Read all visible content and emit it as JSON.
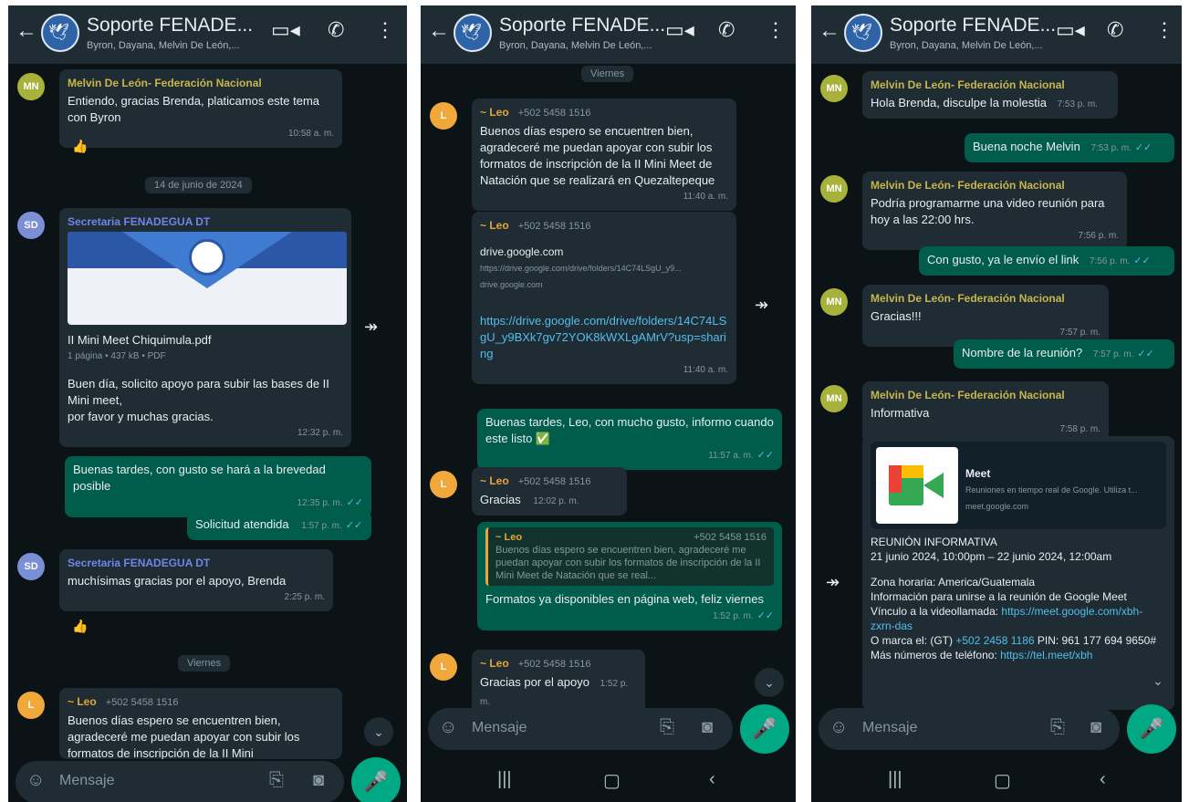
{
  "header": {
    "title": "Soporte FENADE...",
    "subtitle": "Byron, Dayana, Melvin De León,..."
  },
  "input": {
    "placeholder": "Mensaje"
  },
  "phone1": {
    "m1": {
      "sender": "Melvin De León- Federación Nacional",
      "text": "Entiendo, gracias Brenda, platicamos este tema con Byron",
      "time": "10:58 a. m.",
      "reaction": "👍"
    },
    "date1": "14 de junio de 2024",
    "m2": {
      "sender": "Secretaria FENADEGUA DT",
      "file": "II Mini Meet Chiquimula.pdf",
      "file_meta": "1 página • 437 kB • PDF",
      "text": "Buen día, solicito apoyo para subir las bases de II Mini meet,\npor favor y muchas gracias.",
      "time": "12:32 p. m."
    },
    "m3": {
      "text": "Buenas tardes, con gusto se hará a la brevedad posible",
      "time": "12:35 p. m."
    },
    "m4": {
      "text": "Solicitud atendida",
      "time": "1:57 p. m."
    },
    "m5": {
      "sender": "Secretaria FENADEGUA DT",
      "text": "muchísimas gracias por el apoyo, Brenda",
      "time": "2:25 p. m.",
      "reaction": "👍"
    },
    "date2": "Viernes",
    "m6": {
      "sender": "~ Leo",
      "phone": "+502 5458 1516",
      "text": "Buenos días espero se encuentren bien, agradeceré me puedan apoyar con subir los formatos de inscripción de la II Mini"
    }
  },
  "phone2": {
    "date": "Viernes",
    "m1": {
      "sender": "~ Leo",
      "phone": "+502 5458 1516",
      "text": "Buenos días espero se encuentren bien, agradeceré me puedan apoyar con subir los formatos de inscripción de la II Mini Meet de Natación que se realizará en Quezaltepeque",
      "time": "11:40 a. m."
    },
    "m2": {
      "sender": "~ Leo",
      "phone": "+502 5458 1516",
      "link_title": "drive.google.com",
      "link_url": "https://drive.google.com/drive/folders/14C74LSgU_y9...",
      "link_domain": "drive.google.com",
      "text": "https://drive.google.com/drive/folders/14C74LSgU_y9BXk7gv72YOK8kWXLgAMrV?usp=sharing",
      "time": "11:40 a. m."
    },
    "m3": {
      "text": "Buenas tardes, Leo, con mucho gusto, informo cuando este listo ✅",
      "time": "11:57 a. m."
    },
    "m4": {
      "sender": "~ Leo",
      "phone": "+502 5458 1516",
      "text": "Gracias",
      "time": "12:02 p. m."
    },
    "m5": {
      "quote_sender": "~ Leo",
      "quote_phone": "+502 5458 1516",
      "quote_text": "Buenos días espero se encuentren bien, agradeceré me puedan apoyar con subir los formatos de inscripción de la II Mini Meet de Natación que se real...",
      "text": "Formatos ya disponibles en página web, feliz viernes",
      "time": "1:52 p. m."
    },
    "m6": {
      "sender": "~ Leo",
      "phone": "+502 5458 1516",
      "text": "Gracias por el apoyo",
      "time": "1:52 p. m."
    }
  },
  "phone3": {
    "m1": {
      "sender": "Melvin De León- Federación Nacional",
      "text": "Hola Brenda, disculpe la molestia",
      "time": "7:53 p. m."
    },
    "m2": {
      "text": "Buena noche Melvin",
      "time": "7:53 p. m."
    },
    "m3": {
      "sender": "Melvin De León- Federación Nacional",
      "text": "Podría programarme una video reunión para hoy a las 22:00 hrs.",
      "time": "7:56 p. m."
    },
    "m4": {
      "text": "Con gusto, ya le envío el link",
      "time": "7:56 p. m."
    },
    "m5": {
      "sender": "Melvin De León- Federación Nacional",
      "text": "Gracias!!!",
      "time": "7:57 p. m."
    },
    "m6": {
      "text": "Nombre de la reunión?",
      "time": "7:57 p. m."
    },
    "m7": {
      "sender": "Melvin De León- Federación Nacional",
      "text": "Informativa",
      "time": "7:58 p. m."
    },
    "m8": {
      "card_title": "Meet",
      "card_desc": "Reuniones en tiempo real de Google. Utiliza t...",
      "card_domain": "meet.google.com",
      "l1": "REUNIÓN INFORMATIVA",
      "l2": "21 junio 2024, 10:00pm – 22 junio 2024, 12:00am",
      "l3": "Zona horaria: America/Guatemala",
      "l4": "Información para unirse a la reunión de Google Meet",
      "l5_label": "Vínculo a la videollamada: ",
      "l5_link": "https://meet.google.com/xbh-zxrn-das",
      "l6_label": "O marca el: (GT) ",
      "l6_link": "+502 2458 1186",
      "l6_rest": " PIN: 961 177 694 9650#",
      "l7_label": "Más números de teléfono: ",
      "l7_link": "https://tel.meet/xbh"
    }
  },
  "colors": {
    "bg": "#0c1317",
    "bubble_in": "#1f2c33",
    "bubble_out": "#005c4b",
    "accent": "#00a884",
    "tick": "#53bdeb"
  }
}
